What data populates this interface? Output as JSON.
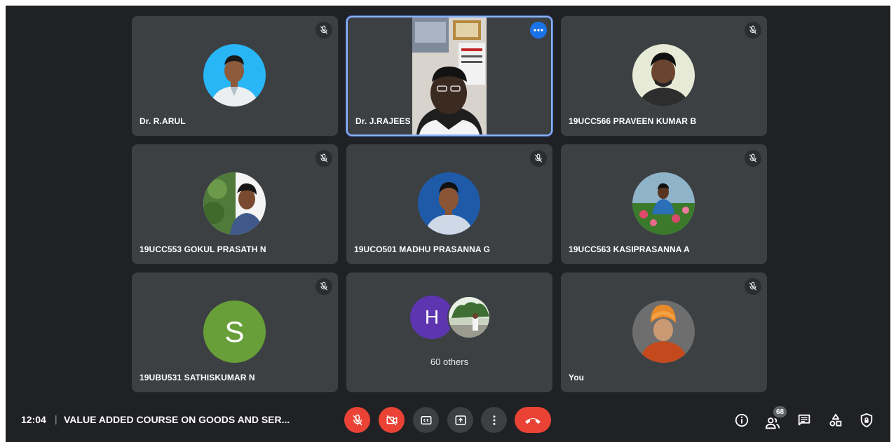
{
  "participants": [
    {
      "name": "Dr. R.ARUL",
      "muted": true,
      "avatar": "photo"
    },
    {
      "name": "Dr. J.RAJEES",
      "muted": false,
      "video": true,
      "active_speaker": true
    },
    {
      "name": "19UCC566 PRAVEEN KUMAR B",
      "muted": true,
      "avatar": "photo"
    },
    {
      "name": "19UCC553 GOKUL PRASATH N",
      "muted": true,
      "avatar": "photo"
    },
    {
      "name": "19UCO501 MADHU PRASANNA G",
      "muted": true,
      "avatar": "photo"
    },
    {
      "name": "19UCC563 KASIPRASANNA A",
      "muted": true,
      "avatar": "photo"
    },
    {
      "name": "19UBU531 SATHISKUMAR N",
      "muted": true,
      "avatar": "letter",
      "letter": "S",
      "color": "#689f38"
    },
    {
      "name": "60 others",
      "group": true,
      "letter": "H",
      "color": "#5e35b1"
    },
    {
      "name": "You",
      "muted": true,
      "avatar": "photo"
    }
  ],
  "bottom_bar": {
    "time": "12:04",
    "separator": "|",
    "meeting_title": "VALUE ADDED COURSE ON GOODS AND SER...",
    "controls": [
      "mic-off-icon",
      "camera-off-icon",
      "captions-icon",
      "present-icon",
      "more-options-icon",
      "hang-up-icon"
    ],
    "right_icons": [
      "info-icon",
      "people-icon",
      "chat-icon",
      "activities-icon",
      "host-controls-icon"
    ],
    "people_count": "68"
  },
  "colors": {
    "background": "#202124",
    "tile": "#3c4043",
    "accent": "#1a73e8",
    "danger": "#ea4335",
    "active_border": "#8ab4f8"
  }
}
